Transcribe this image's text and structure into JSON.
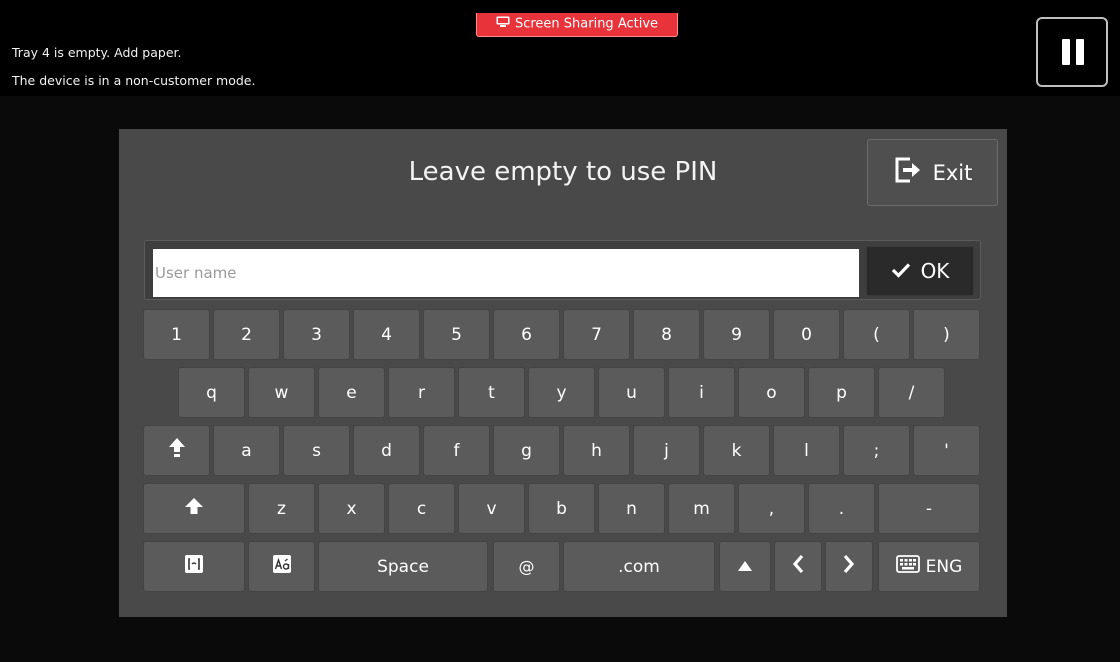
{
  "status": {
    "screen_sharing": "Screen Sharing Active",
    "line1": "Tray 4 is empty.  Add paper.",
    "line2": "The device is in a non-customer mode."
  },
  "icons": {
    "screen_share": "screen-share-icon",
    "pause": "pause-icon",
    "exit": "exit-icon",
    "check": "check-icon",
    "shift": "shift-icon",
    "caps": "caps-lock-icon",
    "symbols": "symbols-icon",
    "accents": "accent-chars-icon",
    "keyboard": "keyboard-icon"
  },
  "colors": {
    "screen_share_badge": "#e8333b",
    "dialog_bg": "#494949",
    "key_bg": "#5b5b5b",
    "ok_bg": "#2a2a2a"
  },
  "dialog": {
    "title": "Leave empty to use PIN",
    "exit_label": "Exit",
    "username_placeholder": "User name",
    "username_value": "",
    "ok_label": "OK"
  },
  "keyboard": {
    "row1": [
      "1",
      "2",
      "3",
      "4",
      "5",
      "6",
      "7",
      "8",
      "9",
      "0",
      "(",
      ")"
    ],
    "row2": [
      "q",
      "w",
      "e",
      "r",
      "t",
      "y",
      "u",
      "i",
      "o",
      "p",
      "/"
    ],
    "row3": [
      "a",
      "s",
      "d",
      "f",
      "g",
      "h",
      "j",
      "k",
      "l",
      ";",
      "'"
    ],
    "row4": [
      "z",
      "x",
      "c",
      "v",
      "b",
      "n",
      "m",
      ",",
      ".",
      "-"
    ],
    "space_label": "Space",
    "at_label": "@",
    "dotcom_label": ".com",
    "lang_label": "ENG"
  }
}
